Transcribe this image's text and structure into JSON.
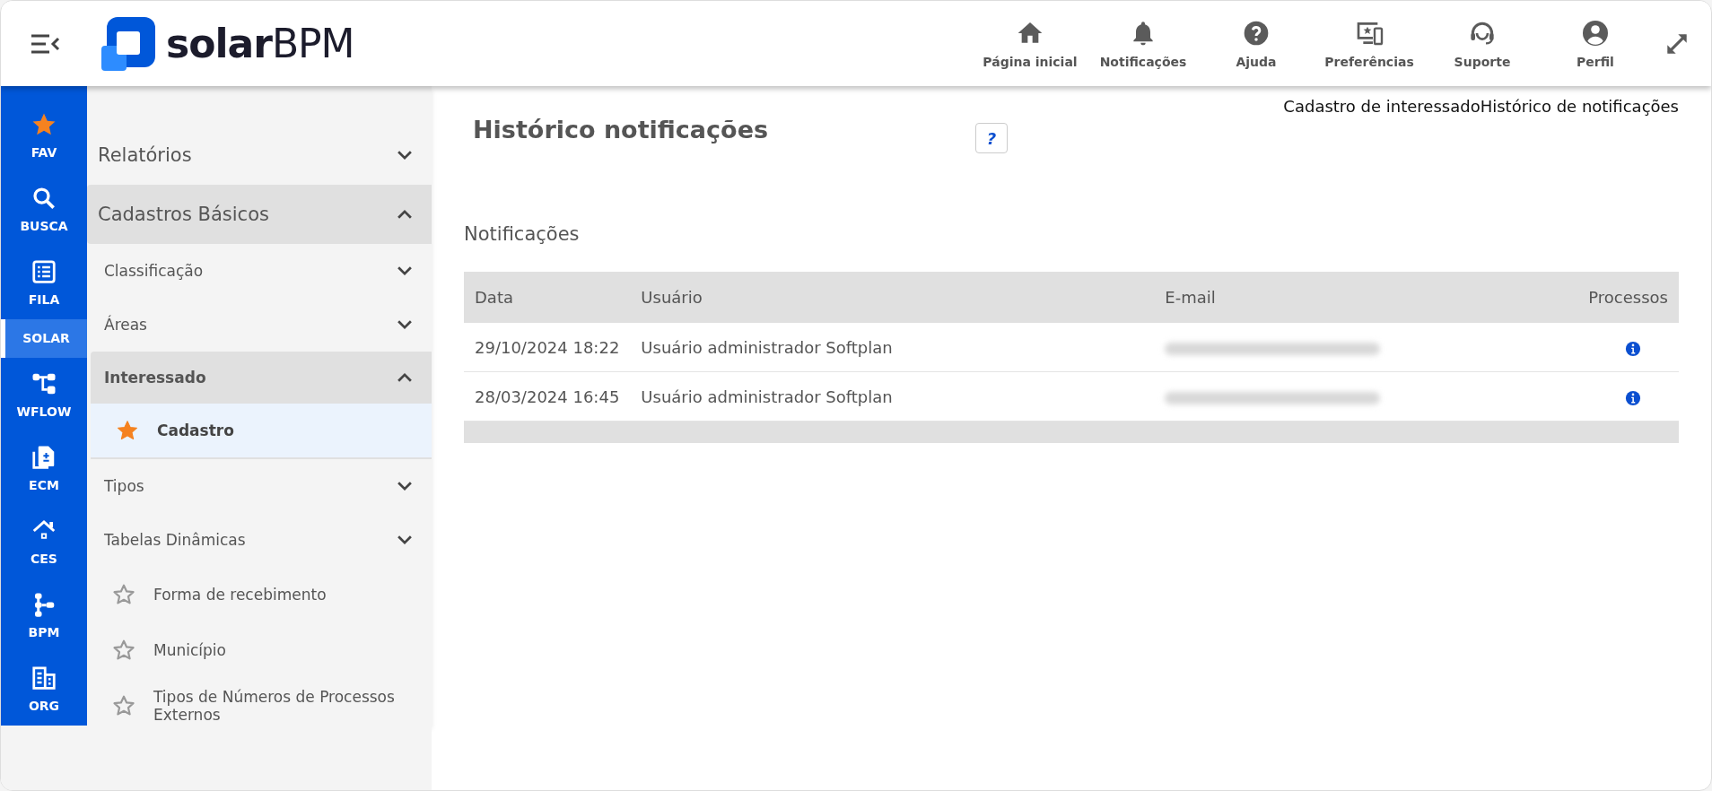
{
  "header": {
    "logo": {
      "brand_bold": "solar",
      "brand_light": "BPM"
    },
    "nav": [
      {
        "label": "Página inicial",
        "kind": "home"
      },
      {
        "label": "Notificações",
        "kind": "bell"
      },
      {
        "label": "Ajuda",
        "kind": "help"
      },
      {
        "label": "Preferências",
        "kind": "prefs"
      },
      {
        "label": "Suporte",
        "kind": "support"
      },
      {
        "label": "Perfil",
        "kind": "profile"
      }
    ]
  },
  "rail": [
    {
      "label": "FAV",
      "kind": "star",
      "selected": false
    },
    {
      "label": "BUSCA",
      "kind": "search",
      "selected": false
    },
    {
      "label": "FILA",
      "kind": "list",
      "selected": false
    },
    {
      "label": "SOLAR",
      "kind": "plain",
      "selected": true
    },
    {
      "label": "WFLOW",
      "kind": "flow",
      "selected": false
    },
    {
      "label": "ECM",
      "kind": "doc",
      "selected": false
    },
    {
      "label": "CES",
      "kind": "house",
      "selected": false
    },
    {
      "label": "BPM",
      "kind": "tree",
      "selected": false
    },
    {
      "label": "ORG",
      "kind": "org",
      "selected": false
    }
  ],
  "sidebar": {
    "items": [
      {
        "kind": "group",
        "label": "Relatórios",
        "expanded": false
      },
      {
        "kind": "group",
        "label": "Cadastros Básicos",
        "expanded": true,
        "children": [
          {
            "kind": "group",
            "label": "Classificação",
            "expanded": false
          },
          {
            "kind": "group",
            "label": "Áreas",
            "expanded": false
          },
          {
            "kind": "group",
            "label": "Interessado",
            "expanded": true,
            "children": [
              {
                "kind": "link",
                "label": "Cadastro",
                "favorite": true,
                "selected": true
              }
            ]
          },
          {
            "kind": "group",
            "label": "Tipos",
            "expanded": false
          },
          {
            "kind": "group",
            "label": "Tabelas Dinâmicas",
            "expanded": false
          },
          {
            "kind": "link",
            "label": "Forma de recebimento",
            "favorite": false,
            "selected": false
          },
          {
            "kind": "link",
            "label": "Município",
            "favorite": false,
            "selected": false
          },
          {
            "kind": "link",
            "label": "Tipos de Números de Processos Externos",
            "favorite": false,
            "selected": false
          }
        ]
      }
    ]
  },
  "breadcrumb": [
    "Cadastro de interessado",
    "Histórico de notificações"
  ],
  "page": {
    "title": "Histórico notificações",
    "help_button": "?",
    "section": "Notificações"
  },
  "table": {
    "columns": [
      "Data",
      "Usuário",
      "E-mail",
      "Processos"
    ],
    "rows": [
      {
        "date": "29/10/2024 18:22",
        "user": "Usuário administrador Softplan",
        "email_blurred": true
      },
      {
        "date": "28/03/2024 16:45",
        "user": "Usuário administrador Softplan",
        "email_blurred": true
      }
    ]
  }
}
